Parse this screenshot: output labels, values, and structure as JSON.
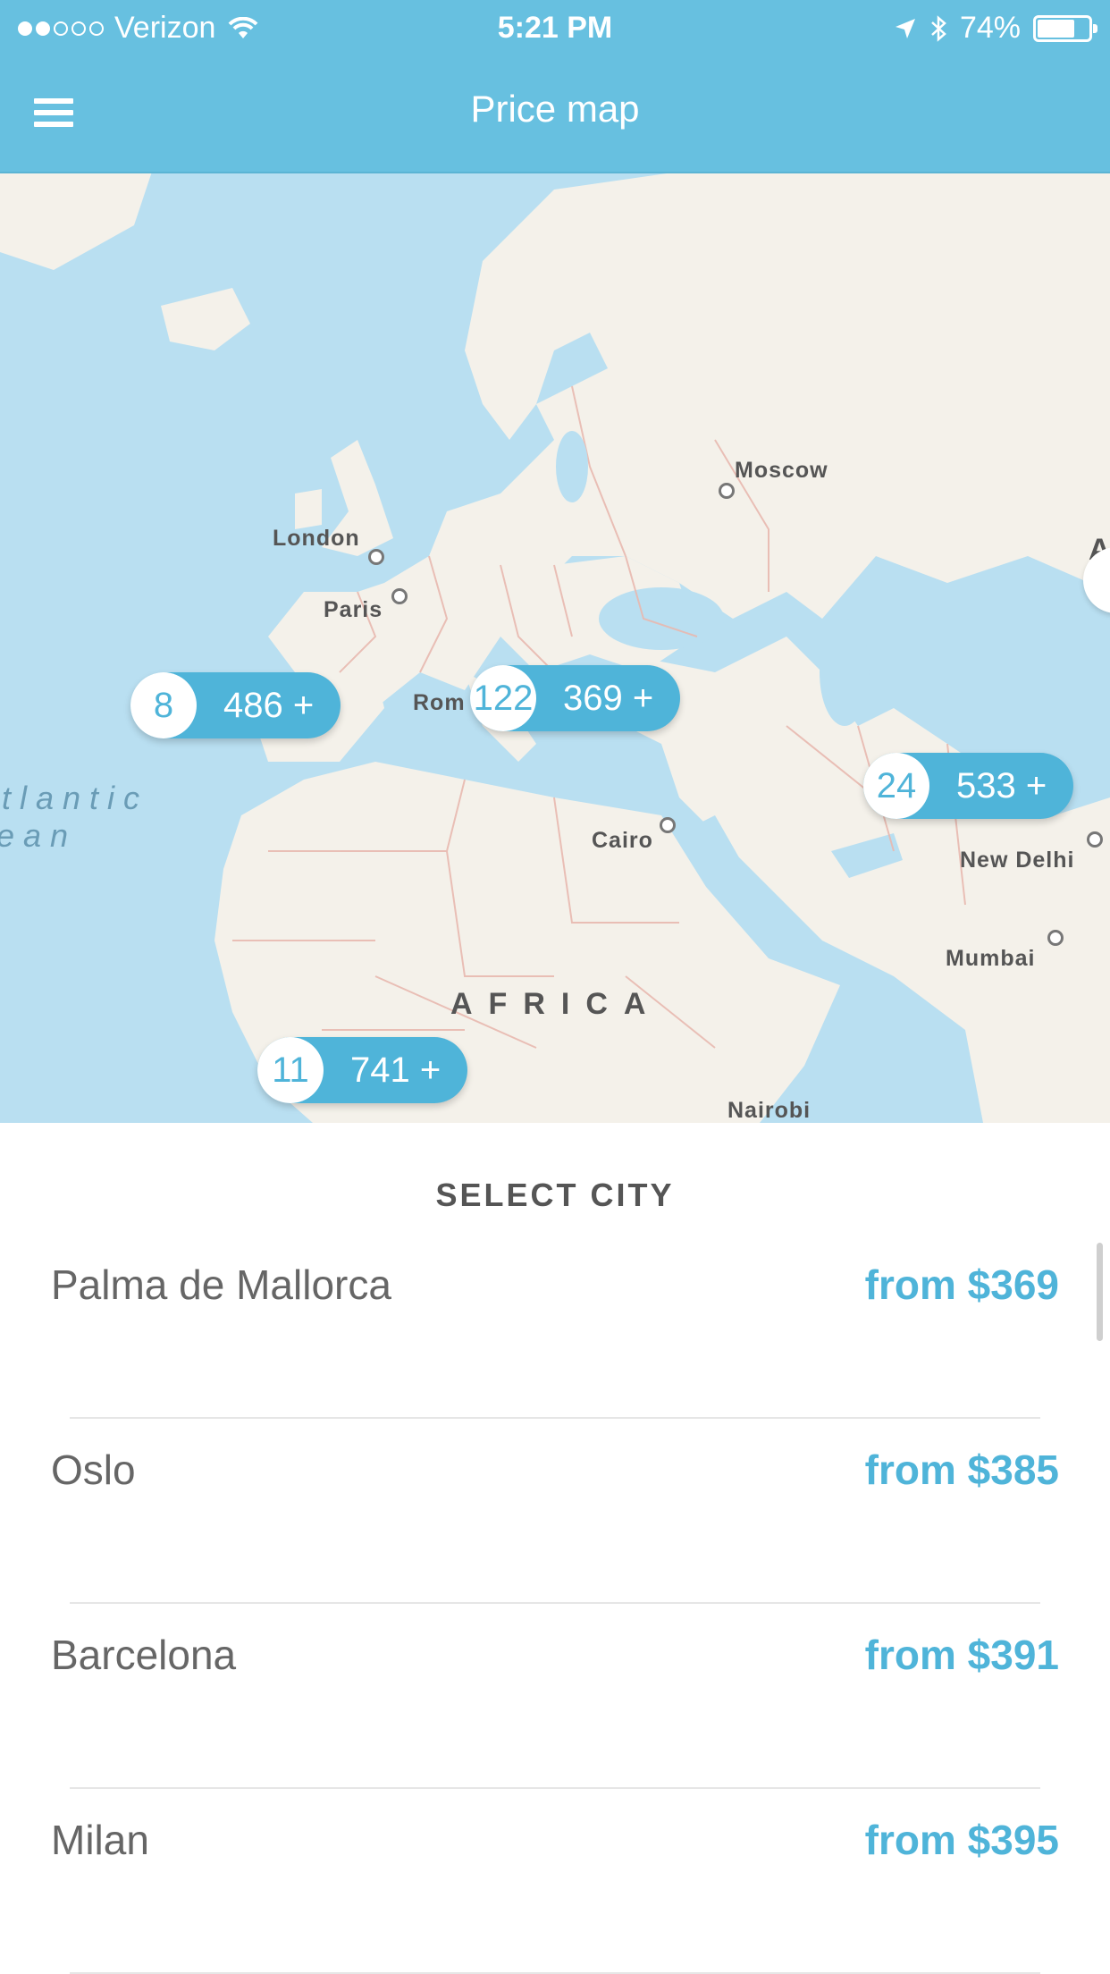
{
  "status_bar": {
    "carrier": "Verizon",
    "time": "5:21 PM",
    "battery": "74%",
    "battery_level": 0.74,
    "signal_bars_filled": 2,
    "signal_bars_total": 5
  },
  "nav": {
    "title": "Price map",
    "menu_icon": "hamburger-menu-icon"
  },
  "map": {
    "cities": [
      "Moscow",
      "London",
      "Paris",
      "Rom",
      "Cairo",
      "New Delhi",
      "Mumbai",
      "Nairobi"
    ],
    "region": "AFRICA",
    "ocean_lines": [
      "tlantic",
      "ean"
    ],
    "edge_letter": "A",
    "clusters": [
      {
        "count": "8",
        "price": "486 +"
      },
      {
        "count": "122",
        "price": "369 +"
      },
      {
        "count": "24",
        "price": "533 +"
      },
      {
        "count": "11",
        "price": "741 +"
      }
    ]
  },
  "list": {
    "title": "SELECT CITY",
    "items": [
      {
        "name": "Palma de Mallorca",
        "price": "from $369"
      },
      {
        "name": "Oslo",
        "price": "from $385"
      },
      {
        "name": "Barcelona",
        "price": "from $391"
      },
      {
        "name": "Milan",
        "price": "from $395"
      }
    ]
  },
  "colors": {
    "accent": "#4fb4d9",
    "header": "#67c0e0",
    "water": "#b9dff1",
    "land": "#f4f1ea"
  }
}
